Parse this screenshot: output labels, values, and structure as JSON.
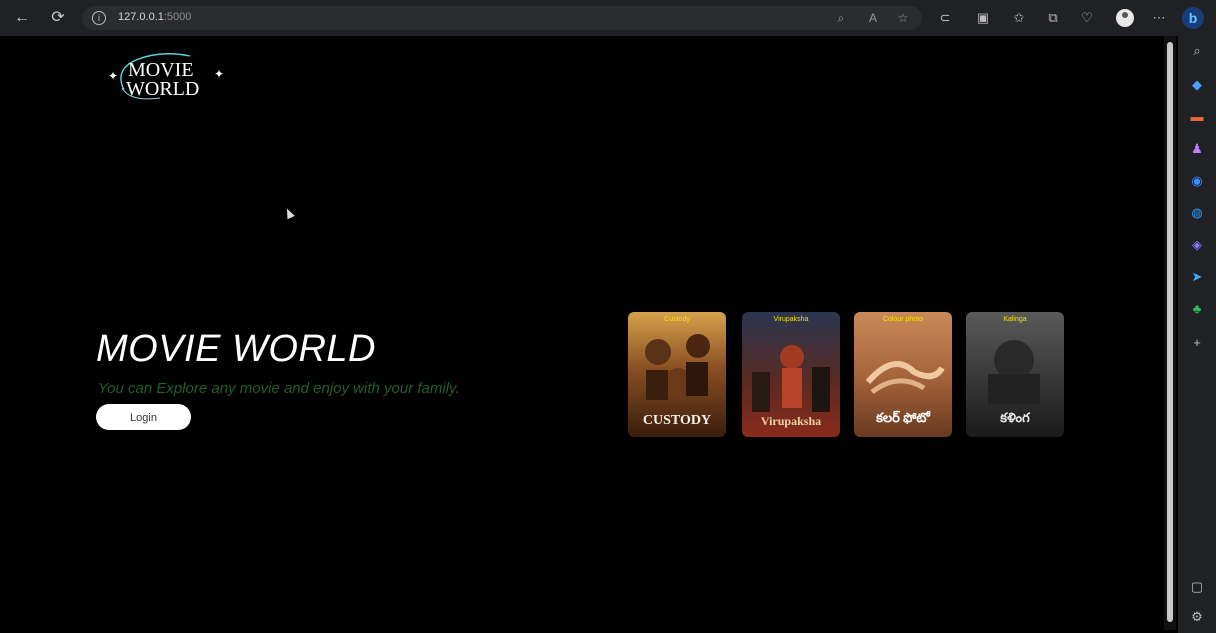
{
  "browser": {
    "url_host": "127.0.0.1",
    "url_port": ":5000"
  },
  "page": {
    "hero_title": "MOVIE WORLD",
    "hero_subtitle": "You can Explore any movie and enjoy with your family.",
    "login_label": "Login",
    "logo_line1": "MOVIE",
    "logo_line2": "WORLD"
  },
  "posters": [
    {
      "tag": "Custody",
      "title": "CUSTODY"
    },
    {
      "tag": "Virupaksha",
      "title": "Virupaksha"
    },
    {
      "tag": "Colour photo",
      "title": "కలర్ ఫోటో"
    },
    {
      "tag": "Kalinga",
      "title": "కళింగ"
    }
  ],
  "colors": {
    "accent": "#1f5f2a",
    "bg": "#000000",
    "chrome": "#202124"
  }
}
